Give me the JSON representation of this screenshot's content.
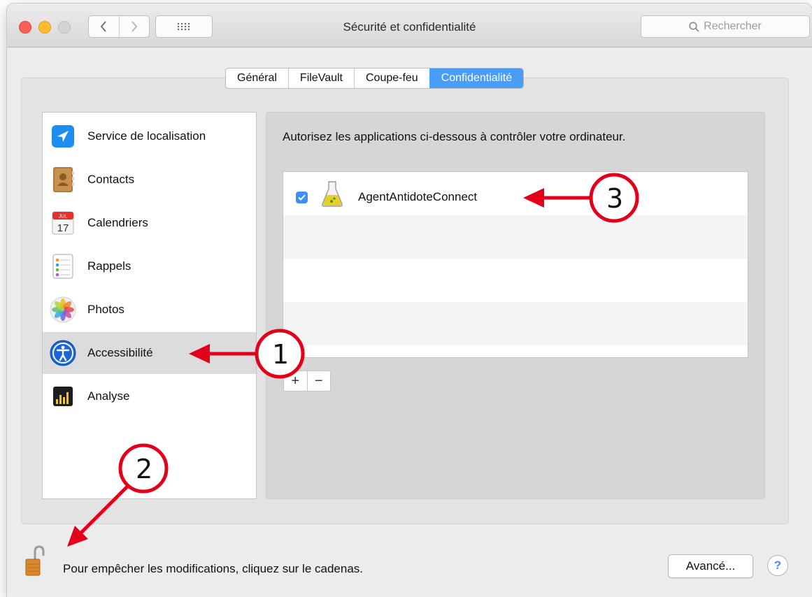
{
  "window": {
    "title": "Sécurité et confidentialité",
    "search_placeholder": "Rechercher"
  },
  "tabs": [
    {
      "label": "Général",
      "active": false
    },
    {
      "label": "FileVault",
      "active": false
    },
    {
      "label": "Coupe-feu",
      "active": false
    },
    {
      "label": "Confidentialité",
      "active": true
    }
  ],
  "sidebar": {
    "items": [
      {
        "label": "Service de localisation",
        "icon": "location-arrow-icon"
      },
      {
        "label": "Contacts",
        "icon": "contacts-book-icon"
      },
      {
        "label": "Calendriers",
        "icon": "calendar-icon"
      },
      {
        "label": "Rappels",
        "icon": "reminders-icon"
      },
      {
        "label": "Photos",
        "icon": "photos-flower-icon"
      },
      {
        "label": "Accessibilité",
        "icon": "accessibility-icon",
        "selected": true
      },
      {
        "label": "Analyse",
        "icon": "analytics-icon"
      }
    ],
    "calendar_month": "JUL",
    "calendar_day": "17"
  },
  "main": {
    "instruction": "Autorisez les applications ci-dessous à contrôler votre ordinateur.",
    "apps": [
      {
        "name": "AgentAntidoteConnect",
        "checked": true,
        "icon": "flask-icon"
      }
    ],
    "add_label": "+",
    "remove_label": "−"
  },
  "footer": {
    "lock_text": "Pour empêcher les modifications, cliquez sur le cadenas.",
    "advanced_label": "Avancé...",
    "help_label": "?"
  },
  "annotations": {
    "marker_1": "1",
    "marker_2": "2",
    "marker_3": "3",
    "color": "#e3001b"
  },
  "colors": {
    "accent": "#4a9df6",
    "checkbox": "#3b8ff5",
    "close": "#fc5f57",
    "minimize": "#fdbc2e"
  }
}
